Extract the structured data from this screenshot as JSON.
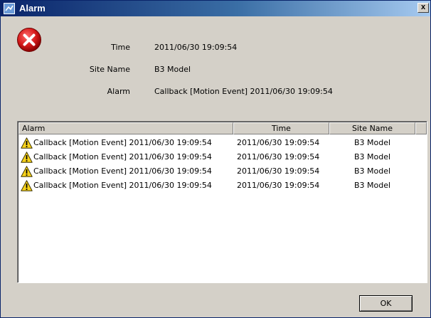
{
  "window": {
    "title": "Alarm",
    "close_label": "x"
  },
  "colors": {
    "titlebar_start": "#0a246a",
    "titlebar_end": "#a6caf0",
    "dialog_bg": "#d4d0c8",
    "error_red": "#cc1111",
    "warning_yellow": "#f7d21a"
  },
  "icons": {
    "window_icon": "app-icon",
    "error_icon": "error-icon",
    "row_icon": "warning-icon"
  },
  "details": [
    {
      "label": "Time",
      "value": "2011/06/30 19:09:54"
    },
    {
      "label": "Site Name",
      "value": "B3 Model"
    },
    {
      "label": "Alarm",
      "value": "Callback [Motion Event] 2011/06/30 19:09:54"
    }
  ],
  "table": {
    "columns": [
      "Alarm",
      "Time",
      "Site Name"
    ],
    "rows": [
      {
        "alarm": "Callback [Motion Event] 2011/06/30 19:09:54",
        "time": "2011/06/30 19:09:54",
        "site": "B3 Model"
      },
      {
        "alarm": "Callback [Motion Event] 2011/06/30 19:09:54",
        "time": "2011/06/30 19:09:54",
        "site": "B3 Model"
      },
      {
        "alarm": "Callback [Motion Event] 2011/06/30 19:09:54",
        "time": "2011/06/30 19:09:54",
        "site": "B3 Model"
      },
      {
        "alarm": "Callback [Motion Event] 2011/06/30 19:09:54",
        "time": "2011/06/30 19:09:54",
        "site": "B3 Model"
      }
    ]
  },
  "buttons": {
    "ok_label": "OK"
  }
}
